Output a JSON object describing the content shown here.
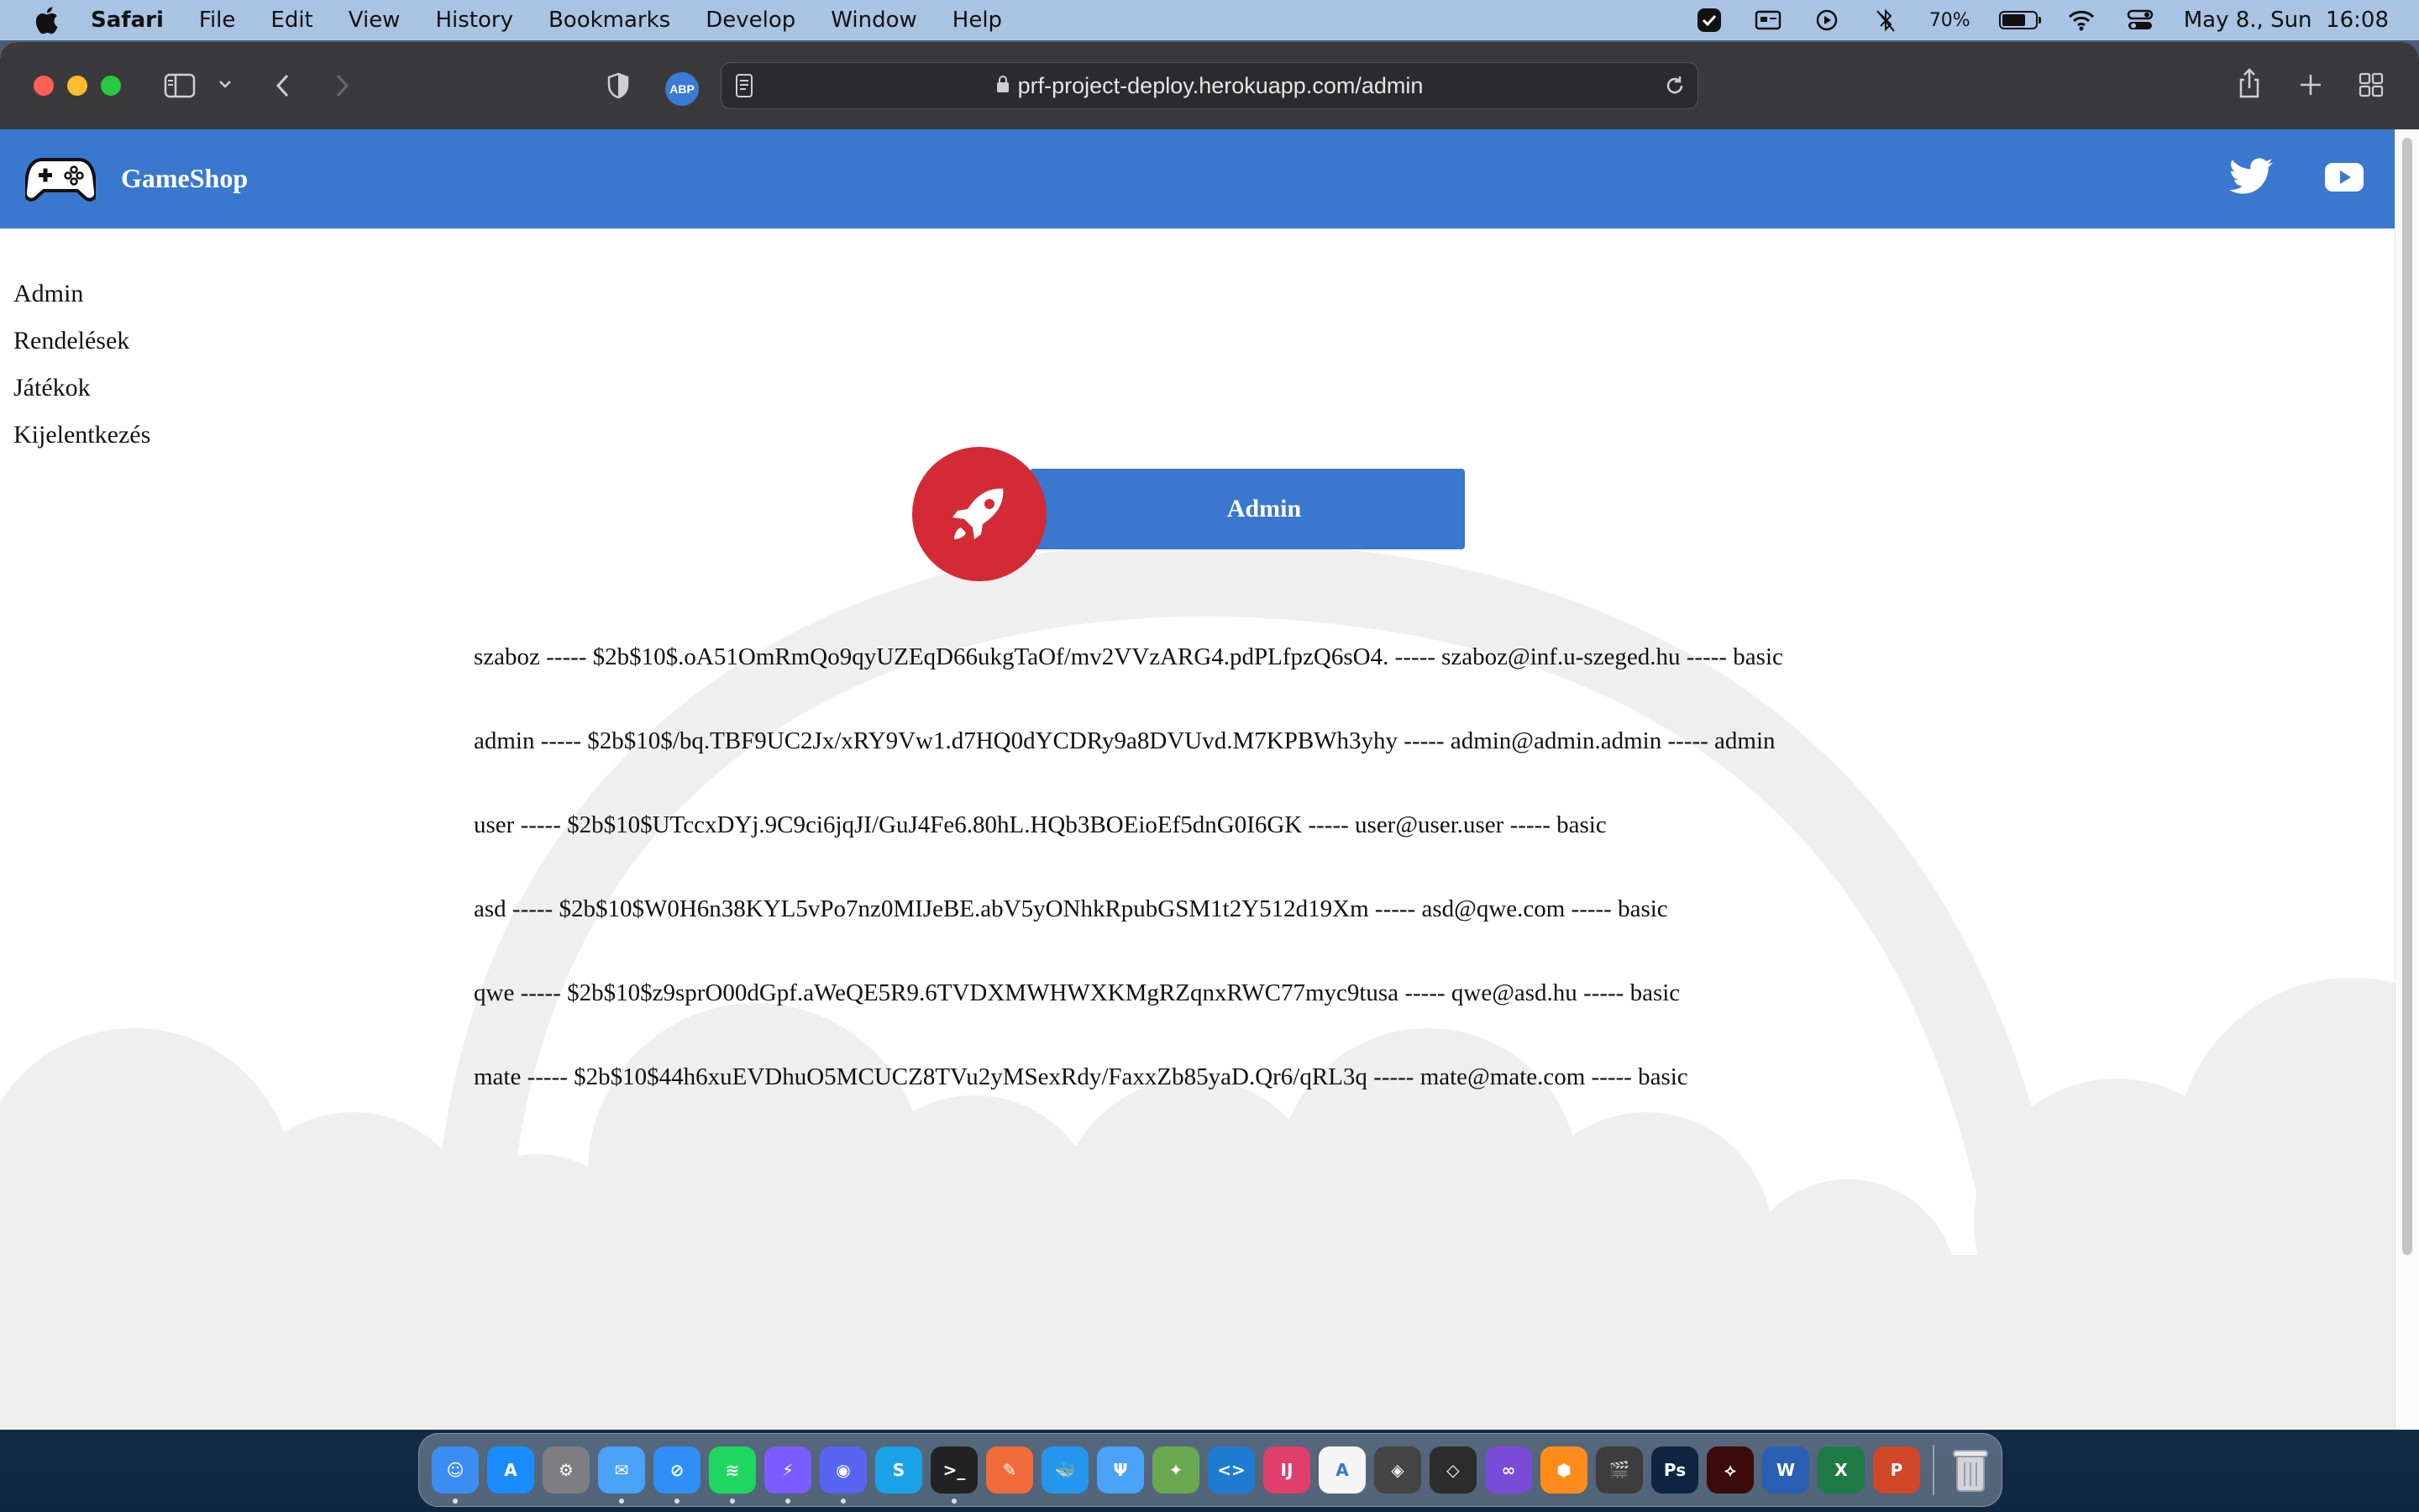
{
  "menubar": {
    "items": [
      "Safari",
      "File",
      "Edit",
      "View",
      "History",
      "Bookmarks",
      "Develop",
      "Window",
      "Help"
    ],
    "battery_percent": "70%",
    "battery_level": 0.7,
    "datetime": "May 8., Sun  16:08"
  },
  "browser": {
    "url": "prf-project-deploy.herokuapp.com/admin",
    "abp_label": "ABP"
  },
  "navbar": {
    "brand": "GameShop",
    "social": [
      "twitter-icon",
      "youtube-icon"
    ]
  },
  "sidenav": {
    "links": [
      "Admin",
      "Rendelések",
      "Játékok",
      "Kijelentkezés"
    ]
  },
  "admin": {
    "title": "Admin",
    "icon": "rocket-icon"
  },
  "users": [
    "szaboz ----- $2b$10$.oA51OmRmQo9qyUZEqD66ukgTaOf/mv2VVzARG4.pdPLfpzQ6sO4. ----- szaboz@inf.u-szeged.hu ----- basic",
    "admin ----- $2b$10$/bq.TBF9UC2Jx/xRY9Vw1.d7HQ0dYCDRy9a8DVUvd.M7KPBWh3yhy ----- admin@admin.admin ----- admin",
    "user ----- $2b$10$UTccxDYj.9C9ci6jqJI/GuJ4Fe6.80hL.HQb3BOEioEf5dnG0I6GK ----- user@user.user ----- basic",
    "asd ----- $2b$10$W0H6n38KYL5vPo7nz0MIJeBE.abV5yONhkRpubGSM1t2Y512d19Xm ----- asd@qwe.com ----- basic",
    "qwe ----- $2b$10$z9sprO00dGpf.aWeQE5R9.6TVDXMWHWXKMgRZqnxRWC77myc9tusa ----- qwe@asd.hu ----- basic",
    "mate ----- $2b$10$44h6xuEVDhuO5MCUCZ8TVu2yMSexRdy/FaxxZb85yaD.Qr6/qRL3q ----- mate@mate.com ----- basic"
  ],
  "dock": {
    "apps": [
      {
        "name": "finder",
        "color": "#3b8ef0",
        "glyph": "☺"
      },
      {
        "name": "app-store",
        "color": "#1a8cff",
        "glyph": "A"
      },
      {
        "name": "system-preferences",
        "color": "#7d7d82",
        "glyph": "⚙"
      },
      {
        "name": "mail",
        "color": "#4aa3f7",
        "glyph": "✉"
      },
      {
        "name": "safari",
        "color": "#2f8ff5",
        "glyph": "⊘"
      },
      {
        "name": "spotify",
        "color": "#1ed760",
        "glyph": "≋"
      },
      {
        "name": "messenger",
        "color": "#7b5cff",
        "glyph": "⚡"
      },
      {
        "name": "discord",
        "color": "#5865f2",
        "glyph": "◉"
      },
      {
        "name": "skype",
        "color": "#1aa3e8",
        "glyph": "S"
      },
      {
        "name": "terminal",
        "color": "#222222",
        "glyph": ">_"
      },
      {
        "name": "swift-playgrounds",
        "color": "#f26b3a",
        "glyph": "✎"
      },
      {
        "name": "docker",
        "color": "#2496ed",
        "glyph": "🐳"
      },
      {
        "name": "fork",
        "color": "#4aa3f7",
        "glyph": "Ψ"
      },
      {
        "name": "sourcetree",
        "color": "#6aa84f",
        "glyph": "✦"
      },
      {
        "name": "vscode",
        "color": "#1f7bd1",
        "glyph": "<>"
      },
      {
        "name": "intellij",
        "color": "#e03e6b",
        "glyph": "IJ"
      },
      {
        "name": "android-studio",
        "color": "#f5f5f5",
        "glyph": "A"
      },
      {
        "name": "unity",
        "color": "#444444",
        "glyph": "◈"
      },
      {
        "name": "unity-hub",
        "color": "#2c2c2c",
        "glyph": "◇"
      },
      {
        "name": "visual-studio",
        "color": "#7a4bd6",
        "glyph": "∞"
      },
      {
        "name": "sourcetree-alt",
        "color": "#ff8c1a",
        "glyph": "⬢"
      },
      {
        "name": "final-cut",
        "color": "#3d3d3d",
        "glyph": "🎬"
      },
      {
        "name": "photoshop",
        "color": "#0f2440",
        "glyph": "Ps"
      },
      {
        "name": "acrobat",
        "color": "#3b0a0a",
        "glyph": "⟡"
      },
      {
        "name": "word",
        "color": "#2b5fb4",
        "glyph": "W"
      },
      {
        "name": "excel",
        "color": "#1f7a45",
        "glyph": "X"
      },
      {
        "name": "powerpoint",
        "color": "#d24726",
        "glyph": "P"
      }
    ],
    "trash": "trash-icon"
  }
}
